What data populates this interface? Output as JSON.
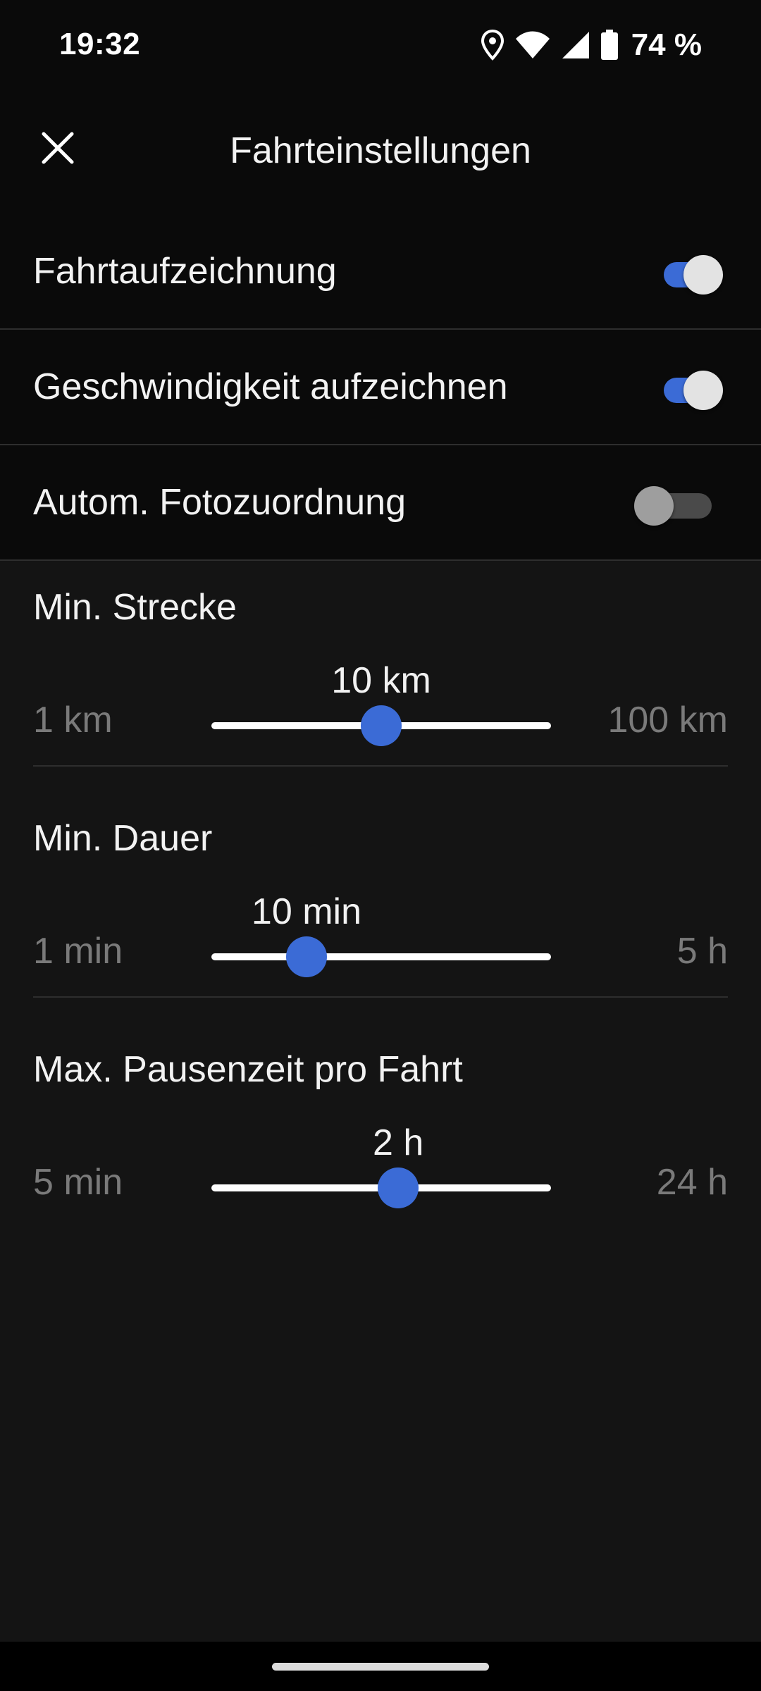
{
  "status_bar": {
    "time": "19:32",
    "battery": "74 %",
    "icons": [
      "location-icon",
      "wifi-icon",
      "signal-icon",
      "battery-icon"
    ]
  },
  "app_bar": {
    "title": "Fahrteinstellungen",
    "close_icon": "close-icon"
  },
  "toggles": [
    {
      "label": "Fahrtaufzeichnung",
      "on": true
    },
    {
      "label": "Geschwindigkeit aufzeichnen",
      "on": true
    },
    {
      "label": "Autom. Fotozuordnung",
      "on": false
    }
  ],
  "sliders": [
    {
      "title": "Min. Strecke",
      "min": "1 km",
      "max": "100 km",
      "value": "10 km",
      "fraction": 0.5
    },
    {
      "title": "Min. Dauer",
      "min": "1 min",
      "max": "5 h",
      "value": "10 min",
      "fraction": 0.28
    },
    {
      "title": "Max. Pausenzeit pro Fahrt",
      "min": "5 min",
      "max": "24 h",
      "value": "2 h",
      "fraction": 0.55
    }
  ],
  "colors": {
    "accent": "#3b6bd6",
    "background": "#141414",
    "surface": "#0a0a0a",
    "text_primary": "#f2f2f2",
    "text_secondary": "#7a7a7a"
  }
}
